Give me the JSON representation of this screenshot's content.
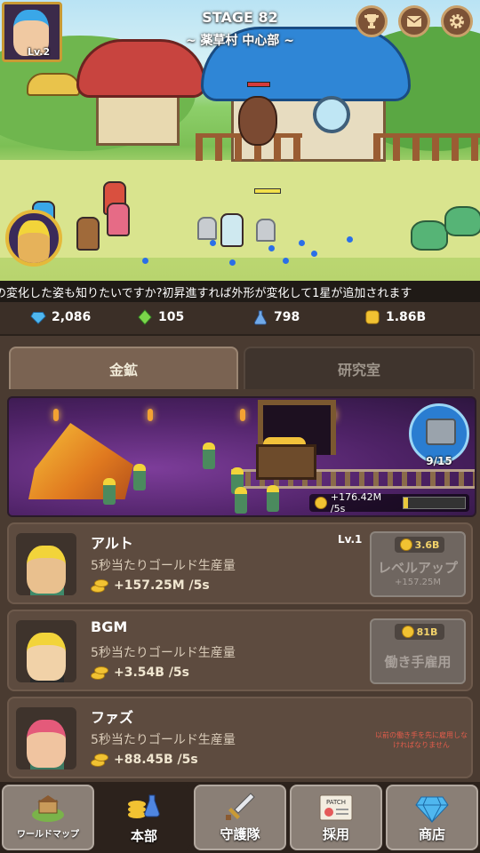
{
  "stage": {
    "title": "STAGE 82",
    "subtitle": "~ 薬草村 中心部 ~"
  },
  "player": {
    "level_badge": "Lv.2"
  },
  "top_buttons": [
    "trophy-icon",
    "mail-icon",
    "gear-icon"
  ],
  "ticker": "の変化した姿も知りたいですか?初昇進すれば外形が変化して1星が追加されます",
  "resources": {
    "diamond": "2,086",
    "green_gem": "105",
    "potion": "798",
    "gold": "1.86B"
  },
  "tabs": {
    "gold_mine": "金鉱",
    "laboratory": "研究室"
  },
  "mine": {
    "chest_count": "9/15",
    "rate": "+176.42M /5s",
    "progress": 0.08
  },
  "workers": [
    {
      "name": "アルト",
      "desc": "5秒当たりゴールド生産量",
      "rate": "+157.25M /5s",
      "level": "Lv.1",
      "action": {
        "cost": "3.6B",
        "label": "レベルアップ",
        "sub": "+157.25M"
      }
    },
    {
      "name": "BGM",
      "desc": "5秒当たりゴールド生産量",
      "rate": "+3.54B /5s",
      "action": {
        "cost": "81B",
        "label": "働き手雇用"
      }
    },
    {
      "name": "ファズ",
      "desc": "5秒当たりゴールド生産量",
      "rate": "+88.45B /5s",
      "note": "以前の働き手を先に雇用しなければなりません"
    }
  ],
  "nav": [
    {
      "label": "ワールドマップ",
      "icon": "world-map-icon"
    },
    {
      "label": "本部",
      "icon": "headquarters-icon"
    },
    {
      "label": "守護隊",
      "icon": "sword-icon"
    },
    {
      "label": "採用",
      "icon": "patch-recruit-icon"
    },
    {
      "label": "商店",
      "icon": "diamond-shop-icon"
    }
  ],
  "colors": {
    "gold": "#f1c232",
    "accent_blue": "#2f86d6",
    "panel": "#5d4b3f",
    "note_red": "#e25c4b"
  }
}
